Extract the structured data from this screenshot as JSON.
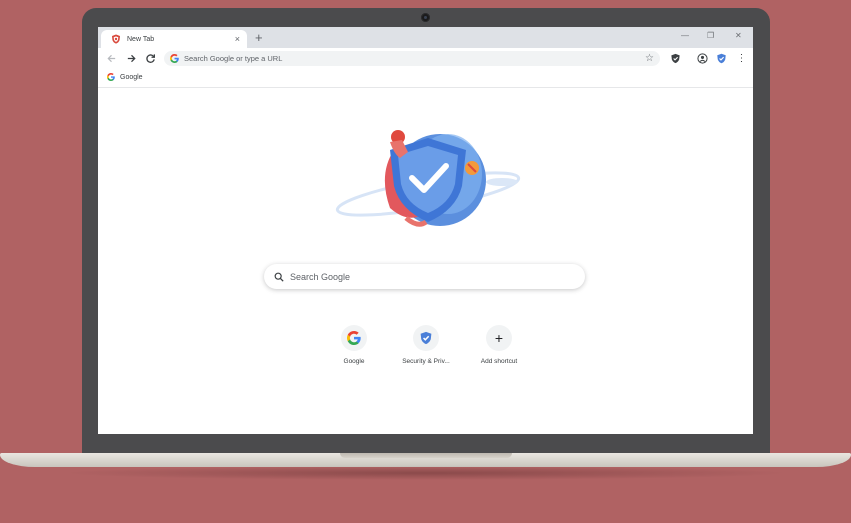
{
  "browser": {
    "tab": {
      "title": "New Tab",
      "close_glyph": "×"
    },
    "new_tab_glyph": "+",
    "window_controls": {
      "minimize": "—",
      "restore": "❐",
      "close": "✕"
    }
  },
  "toolbar": {
    "omnibox_placeholder": "Search Google or type a URL",
    "star_glyph": "☆",
    "menu_glyph": "⋮"
  },
  "bookmarks": [
    {
      "label": "Google",
      "icon": "google-g-icon"
    }
  ],
  "ntp": {
    "search_placeholder": "Search Google",
    "shortcuts": [
      {
        "label": "Google",
        "icon": "google-g-icon"
      },
      {
        "label": "Security & Priv...",
        "icon": "security-shield-icon"
      },
      {
        "label": "Add shortcut",
        "icon": "plus-icon",
        "glyph": "+"
      }
    ]
  },
  "colors": {
    "background": "#b06263",
    "laptop_bezel": "#4b4b4d",
    "tab_strip": "#dee1e6",
    "accent_blue": "#4a7fd8",
    "shield_red": "#e0493e"
  }
}
